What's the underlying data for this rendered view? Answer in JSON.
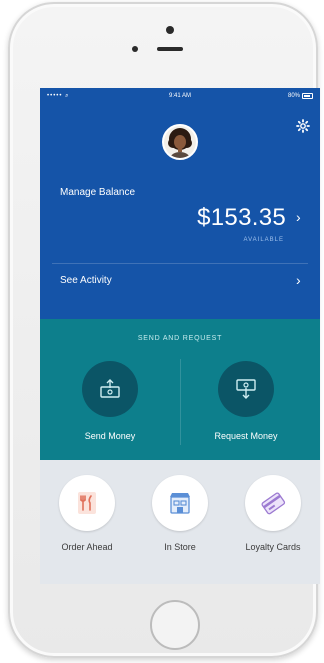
{
  "status_bar": {
    "signal": "••••• ⌕",
    "time": "9:41 AM",
    "battery": "80%"
  },
  "account": {
    "manage_label": "Manage Balance",
    "balance": "$153.35",
    "available_label": "AVAILABLE",
    "activity_label": "See Activity"
  },
  "send_request": {
    "header": "SEND AND REQUEST",
    "send_label": "Send Money",
    "request_label": "Request Money"
  },
  "shortcuts": [
    {
      "label": "Order Ahead",
      "icon": "fork-knife-icon"
    },
    {
      "label": "In Store",
      "icon": "storefront-icon"
    },
    {
      "label": "Loyalty Cards",
      "icon": "loyalty-card-icon"
    }
  ],
  "colors": {
    "header_blue": "#1554a8",
    "send_teal": "#0d7f8c",
    "action_circle": "#0b5566",
    "bottom_gray": "#e3e7ec",
    "order_accent": "#e0705a",
    "store_accent": "#5b8fd6",
    "loyalty_accent": "#9c7ad1"
  }
}
